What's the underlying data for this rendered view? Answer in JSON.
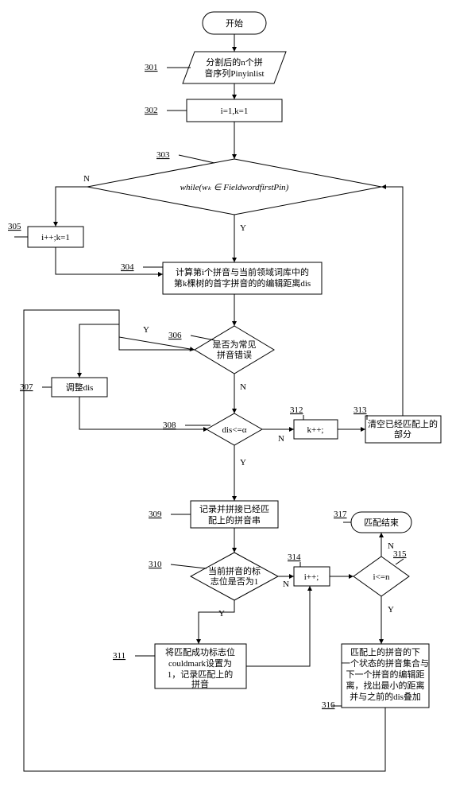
{
  "chart_data": {
    "type": "flowchart",
    "nodes": [
      {
        "id": "start",
        "shape": "terminator",
        "text": "开始",
        "ref": ""
      },
      {
        "id": "n301",
        "shape": "parallelogram",
        "text": "分割后的n个拼音序列Pinyinlist",
        "ref": "301"
      },
      {
        "id": "n302",
        "shape": "process",
        "text": "i=1,k=1",
        "ref": "302"
      },
      {
        "id": "n303",
        "shape": "decision",
        "text": "while(wₖ ∈ FieldwordfirstPin)",
        "ref": "303"
      },
      {
        "id": "n304",
        "shape": "process",
        "text": "计算第i个拼音与当前领域词库中的第k棵树的首字拼音的的编辑距离dis",
        "ref": "304"
      },
      {
        "id": "n305",
        "shape": "process",
        "text": "i++;k=1",
        "ref": "305"
      },
      {
        "id": "n306",
        "shape": "decision",
        "text": "是否为常见拼音错误",
        "ref": "306"
      },
      {
        "id": "n307",
        "shape": "process",
        "text": "调整dis",
        "ref": "307"
      },
      {
        "id": "n308",
        "shape": "decision",
        "text": "dis<=α",
        "ref": "308"
      },
      {
        "id": "n309",
        "shape": "process",
        "text": "记录并拼接已经匹配上的拼音串",
        "ref": "309"
      },
      {
        "id": "n310",
        "shape": "decision",
        "text": "当前拼音的标志位是否为1",
        "ref": "310"
      },
      {
        "id": "n311",
        "shape": "process",
        "text": "将匹配成功标志位couldmark设置为1，记录匹配上的拼音",
        "ref": "311"
      },
      {
        "id": "n312",
        "shape": "process",
        "text": "k++;",
        "ref": "312"
      },
      {
        "id": "n313",
        "shape": "process",
        "text": "清空已经匹配上的部分",
        "ref": "313"
      },
      {
        "id": "n314",
        "shape": "process",
        "text": "i++;",
        "ref": "314"
      },
      {
        "id": "n315",
        "shape": "decision",
        "text": "i<=n",
        "ref": "315"
      },
      {
        "id": "n316",
        "shape": "process",
        "text": "匹配上的拼音的下一个状态的拼音集合与下一个拼音的编辑距离，找出最小的距离并与之前的dis叠加",
        "ref": "316"
      },
      {
        "id": "n317",
        "shape": "terminator",
        "text": "匹配结束",
        "ref": "317"
      }
    ],
    "edges": [
      {
        "from": "start",
        "to": "n301"
      },
      {
        "from": "n301",
        "to": "n302"
      },
      {
        "from": "n302",
        "to": "n303"
      },
      {
        "from": "n303",
        "to": "n304",
        "label": "Y"
      },
      {
        "from": "n303",
        "to": "n305",
        "label": "N"
      },
      {
        "from": "n305",
        "to": "n304"
      },
      {
        "from": "n304",
        "to": "n306"
      },
      {
        "from": "n306",
        "to": "n307",
        "label": "Y"
      },
      {
        "from": "n306",
        "to": "n308",
        "label": "N"
      },
      {
        "from": "n307",
        "to": "n308"
      },
      {
        "from": "n308",
        "to": "n309",
        "label": "Y"
      },
      {
        "from": "n308",
        "to": "n312",
        "label": "N"
      },
      {
        "from": "n312",
        "to": "n313"
      },
      {
        "from": "n313",
        "to": "n303"
      },
      {
        "from": "n309",
        "to": "n310"
      },
      {
        "from": "n310",
        "to": "n311",
        "label": "Y"
      },
      {
        "from": "n310",
        "to": "n314",
        "label": "N"
      },
      {
        "from": "n311",
        "to": "n314"
      },
      {
        "from": "n314",
        "to": "n315"
      },
      {
        "from": "n315",
        "to": "n316",
        "label": "Y"
      },
      {
        "from": "n315",
        "to": "n317",
        "label": "N"
      },
      {
        "from": "n316",
        "to": "n306"
      }
    ]
  },
  "branch": {
    "Y": "Y",
    "N": "N"
  }
}
